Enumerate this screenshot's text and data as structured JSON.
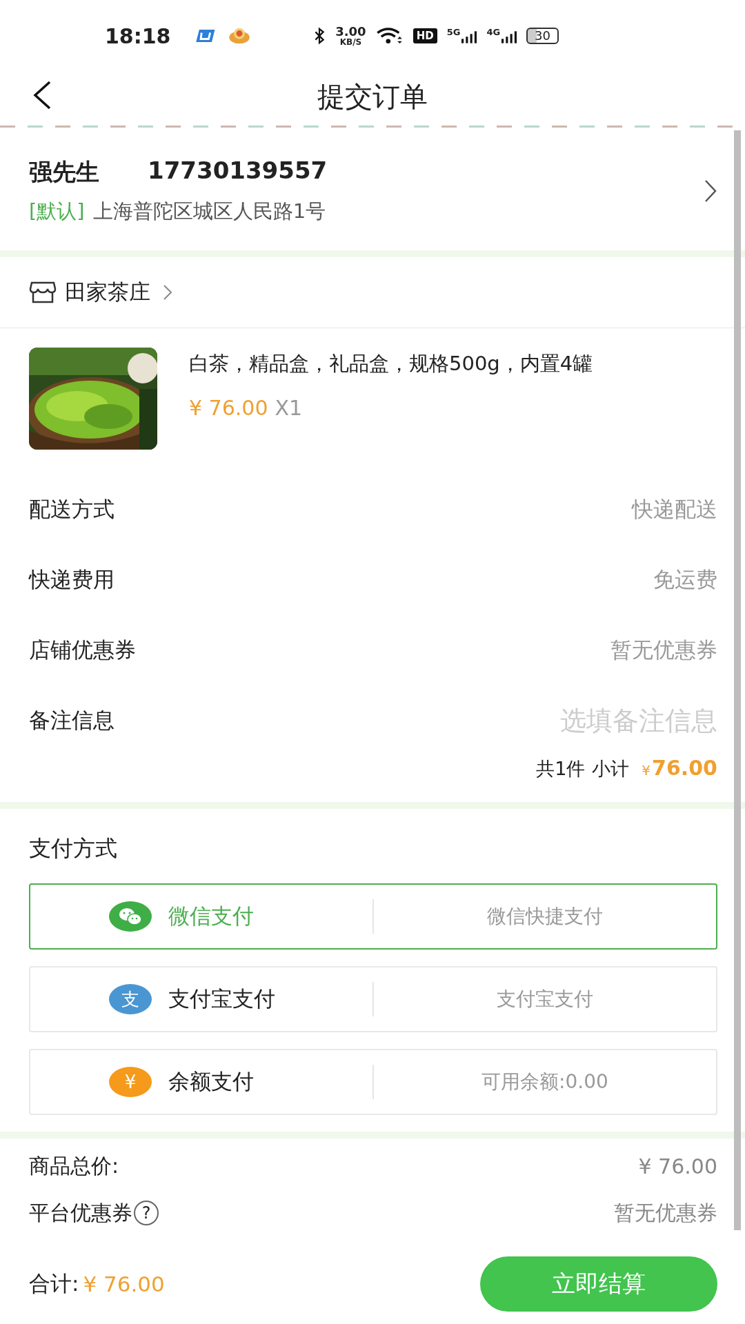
{
  "status_bar": {
    "time": "18:18",
    "speed_value": "3.00",
    "speed_unit": "KB/S",
    "hd": "HD",
    "network_1": "5G",
    "network_2": "4G",
    "battery": "30"
  },
  "header": {
    "title": "提交订单"
  },
  "address": {
    "name": "强先生",
    "phone": "17730139557",
    "default_tag": "[默认]",
    "address": "上海普陀区城区人民路1号"
  },
  "shop": {
    "name": "田家茶庄"
  },
  "product": {
    "title": "白茶，精品盒，礼品盒，规格500g，内置4罐",
    "price": "¥ 76.00",
    "quantity": "X1"
  },
  "details": [
    {
      "label": "配送方式",
      "value": "快递配送",
      "kind": "value"
    },
    {
      "label": "快递费用",
      "value": "免运费",
      "kind": "value"
    },
    {
      "label": "店铺优惠券",
      "value": "暂无优惠券",
      "kind": "value"
    },
    {
      "label": "备注信息",
      "placeholder": "选填备注信息",
      "kind": "field"
    }
  ],
  "subtotal": {
    "count": "共1件",
    "label": "小计",
    "currency": "¥",
    "amount": "76.00"
  },
  "payment": {
    "title": "支付方式",
    "options": [
      {
        "name": "微信支付",
        "description": "微信快捷支付",
        "selected": true,
        "kind": "bubbles",
        "color": "#3fae47"
      },
      {
        "name": "支付宝支付",
        "description": "支付宝支付",
        "selected": false,
        "kind": "glyph",
        "icon_char": "支",
        "color": "#4a96d2"
      },
      {
        "name": "余额支付",
        "description": "可用余额:0.00",
        "selected": false,
        "kind": "glyph",
        "icon_char": "¥",
        "color": "#f59a1b"
      }
    ]
  },
  "summary": [
    {
      "label": "商品总价:",
      "value": "¥ 76.00"
    },
    {
      "label": "平台优惠券",
      "help_mark": "?",
      "value": "暂无优惠券"
    }
  ],
  "footer": {
    "total_label": "合计:",
    "total": "¥ 76.00",
    "button": "立即结算"
  }
}
